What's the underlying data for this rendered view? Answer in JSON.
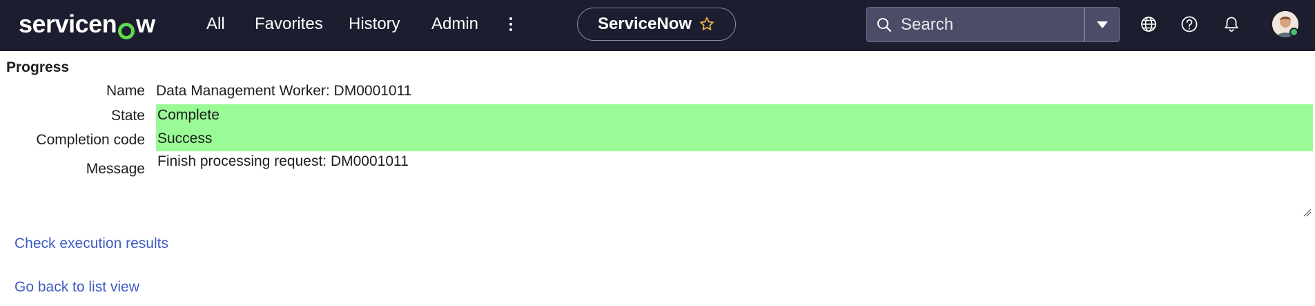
{
  "header": {
    "logo_prefix": "servicen",
    "logo_suffix": "w",
    "nav": {
      "all": "All",
      "favorites": "Favorites",
      "history": "History",
      "admin": "Admin"
    },
    "app_pill": "ServiceNow",
    "search": {
      "placeholder": "Search"
    },
    "icons": [
      "globe-icon",
      "help-icon",
      "bell-icon"
    ],
    "colors": {
      "bar": "#1c1d2e",
      "logo_accent": "#62d84e",
      "presence": "#43c36b"
    }
  },
  "progress": {
    "title": "Progress",
    "fields": {
      "name_label": "Name",
      "name_value": "Data Management Worker: DM0001011",
      "state_label": "State",
      "state_value": "Complete",
      "code_label": "Completion code",
      "code_value": "Success",
      "message_label": "Message",
      "message_value": "Finish processing request: DM0001011"
    },
    "highlight_color": "#9afa96"
  },
  "links": {
    "check_results": "Check execution results",
    "back_to_list": "Go back to list view"
  }
}
